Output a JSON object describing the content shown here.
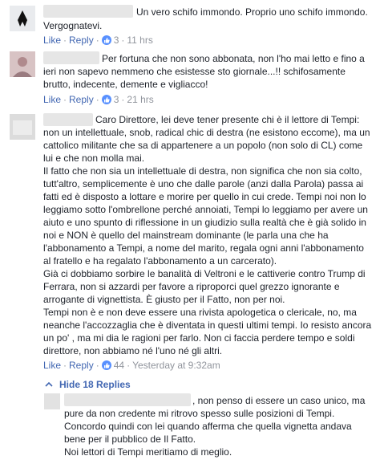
{
  "actions": {
    "like": "Like",
    "reply": "Reply"
  },
  "comments": [
    {
      "lines": [
        "Un vero schifo immondo. Proprio uno schifo immondo.",
        "Vergognatevi."
      ],
      "likes": "3",
      "time": "11 hrs"
    },
    {
      "lines": [
        "Per fortuna che non sono abbonata, non l'ho mai letto e fino a",
        "ieri non sapevo nemmeno che esistesse sto giornale...!! schifosamente",
        "brutto, indecente, demente e vigliacco!"
      ],
      "likes": "3",
      "time": "21 hrs"
    },
    {
      "lines": [
        "Caro Direttore, lei deve tener presente chi è il lettore di Tempi:",
        "non un intellettuale, snob, radical chic di destra (ne esistono eccome), ma un",
        "cattolico militante che sa di appartenere a un popolo (non solo di CL) come",
        "lui e che non molla mai.",
        "Il fatto che non sia un intellettuale di destra, non significa che non sia colto,",
        "tutt'altro, semplicemente è uno che dalle parole (anzi dalla Parola) passa ai",
        "fatti ed è disposto a lottare e morire per quello in cui crede. Tempi noi non lo",
        "leggiamo sotto l'ombrellone perché annoiati, Tempi lo leggiamo per avere un",
        "aiuto e uno spunto di riflessione in un giudizio sulla realtà che è già solido in",
        "noi e NON è quello del mainstream dominante (le parla una che ha",
        "l'abbonamento a Tempi, a nome del marito, regala ogni anni l'abbonamento",
        "al fratello e ha regalato l'abbonamento a un carcerato).",
        "Già ci dobbiamo sorbire le banalità di Veltroni e le cattiverie contro Trump di",
        "Ferrara, non si azzardi per favore a riproporci quel grezzo ignorante e",
        "arrogante di vignettista. È giusto per il Fatto, non per noi.",
        "Tempi non è e non deve essere una rivista apologetica o clericale, no, ma",
        "neanche l'accozzaglia che è diventata in questi ultimi tempi. Io resisto ancora",
        "un po' , ma mi dia le ragioni per farlo. Non ci faccia perdere tempo e soldi",
        "direttore, non abbiamo né l'uno né gli altri."
      ],
      "likes": "44",
      "time": "Yesterday at 9:32am"
    }
  ],
  "hide_replies": "Hide 18 Replies",
  "reply": {
    "lines": [
      ", non penso di essere un caso unico, ma",
      "pure da non credente mi ritrovo spesso sulle posizioni di Tempi.",
      "Concordo quindi con lei quando afferma che quella vignetta andava",
      "bene per il pubblico de Il Fatto.",
      "Noi lettori di Tempi meritiamo di meglio."
    ]
  },
  "colors": {
    "link": "#4267b2",
    "meta": "#90949c",
    "text": "#1d2129",
    "like_badge": "#5890ff"
  }
}
